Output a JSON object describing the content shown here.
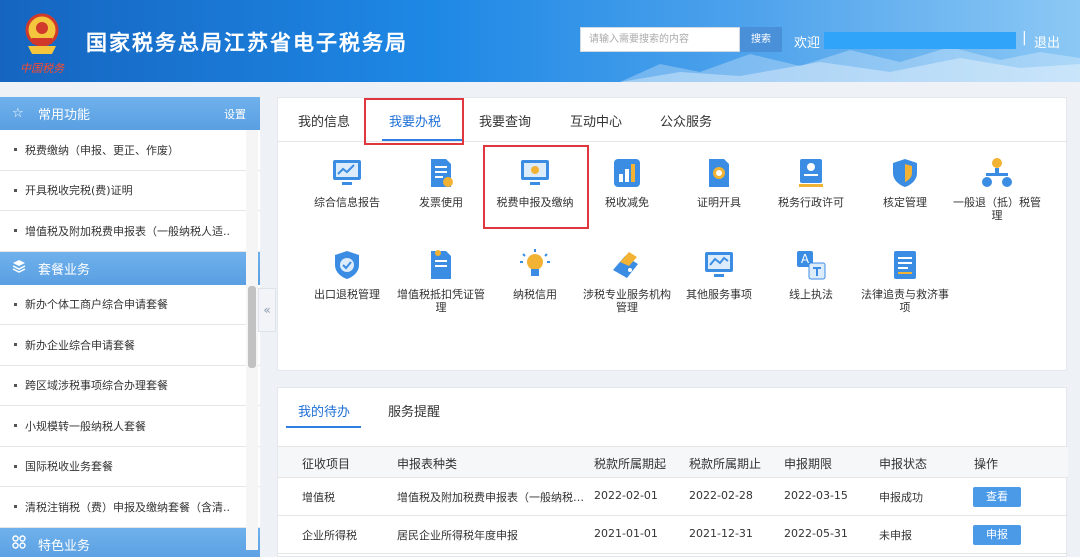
{
  "header": {
    "logo_text": "中国税务",
    "title": "国家税务总局江苏省电子税务局",
    "search_placeholder": "请输入需要搜索的内容",
    "search_button": "搜索",
    "welcome": "欢迎",
    "separator": "|",
    "logout": "退出"
  },
  "sidebar": {
    "sections": [
      {
        "title": "常用功能",
        "icon": "star-icon",
        "action": "设置",
        "items": [
          "税费缴纳（申报、更正、作废）",
          "开具税收完税(费)证明",
          "增值税及附加税费申报表（一般纳税人适.."
        ]
      },
      {
        "title": "套餐业务",
        "icon": "layers-icon",
        "items": [
          "新办个体工商户综合申请套餐",
          "新办企业综合申请套餐",
          "跨区域涉税事项综合办理套餐",
          "小规模转一般纳税人套餐",
          "国际税收业务套餐",
          "清税注销税（费）申报及缴纳套餐（含清.."
        ]
      },
      {
        "title": "特色业务",
        "icon": "grid-icon",
        "items": []
      }
    ]
  },
  "tabs": [
    "我的信息",
    "我要办税",
    "我要查询",
    "互动中心",
    "公众服务"
  ],
  "services": [
    {
      "label": "综合信息报告",
      "icon": "chart-monitor-icon"
    },
    {
      "label": "发票使用",
      "icon": "invoice-icon"
    },
    {
      "label": "税费申报及缴纳",
      "icon": "monitor-icon"
    },
    {
      "label": "税收减免",
      "icon": "bar-chart-icon"
    },
    {
      "label": "证明开具",
      "icon": "certificate-icon"
    },
    {
      "label": "税务行政许可",
      "icon": "badge-icon"
    },
    {
      "label": "核定管理",
      "icon": "shield-icon"
    },
    {
      "label": "一般退（抵）税管理",
      "icon": "org-chart-icon"
    },
    {
      "label": "出口退税管理",
      "icon": "shield-check-icon"
    },
    {
      "label": "增值税抵扣凭证管理",
      "icon": "document-icon"
    },
    {
      "label": "纳税信用",
      "icon": "lightbulb-icon"
    },
    {
      "label": "涉税专业服务机构管理",
      "icon": "tag-icon"
    },
    {
      "label": "其他服务事项",
      "icon": "line-chart-icon"
    },
    {
      "label": "线上执法",
      "icon": "translate-icon"
    },
    {
      "label": "法律追责与救济事项",
      "icon": "list-document-icon"
    }
  ],
  "todo": {
    "tabs": [
      "我的待办",
      "服务提醒"
    ],
    "columns": [
      "征收项目",
      "申报表种类",
      "税款所属期起",
      "税款所属期止",
      "申报期限",
      "申报状态",
      "操作"
    ],
    "rows": [
      {
        "item": "增值税",
        "form": "增值税及附加税费申报表（一般纳税…",
        "start": "2022-02-01",
        "end": "2022-02-28",
        "deadline": "2022-03-15",
        "status": "申报成功",
        "action": "查看"
      },
      {
        "item": "企业所得税",
        "form": "居民企业所得税年度申报",
        "start": "2021-01-01",
        "end": "2021-12-31",
        "deadline": "2022-05-31",
        "status": "未申报",
        "action": "申报"
      }
    ]
  },
  "colors": {
    "accent": "#1e6fd6",
    "highlight": "#e0363d",
    "button": "#4a9ae8",
    "sidebar_header": "#5a9fe2"
  }
}
